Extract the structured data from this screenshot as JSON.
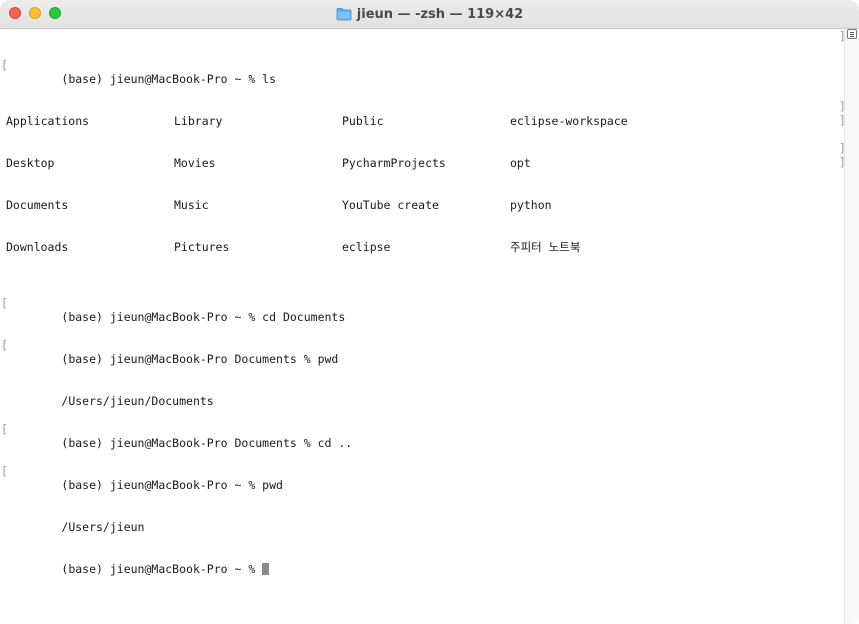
{
  "window": {
    "title": "jieun — -zsh — 119×42"
  },
  "terminal": {
    "ls_prompt": "(base) jieun@MacBook-Pro ~ % ls",
    "ls_output": [
      [
        "Applications",
        "Library",
        "Public",
        "eclipse-workspace"
      ],
      [
        "Desktop",
        "Movies",
        "PycharmProjects",
        "opt"
      ],
      [
        "Documents",
        "Music",
        "YouTube create",
        "python"
      ],
      [
        "Downloads",
        "Pictures",
        "eclipse",
        "주피터 노트북"
      ]
    ],
    "lines": [
      "(base) jieun@MacBook-Pro ~ % cd Documents",
      "(base) jieun@MacBook-Pro Documents % pwd",
      "/Users/jieun/Documents",
      "(base) jieun@MacBook-Pro Documents % cd ..",
      "(base) jieun@MacBook-Pro ~ % pwd",
      "/Users/jieun"
    ],
    "current_prompt": "(base) jieun@MacBook-Pro ~ % "
  }
}
